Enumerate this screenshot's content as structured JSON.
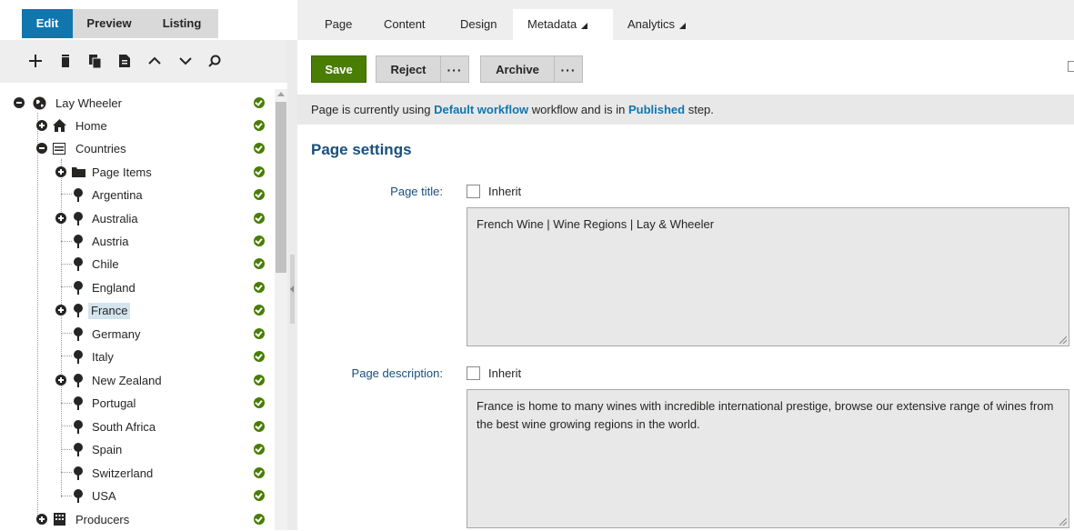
{
  "mode_tabs": [
    "Edit",
    "Preview",
    "Listing"
  ],
  "toolbar_icons": [
    "add-icon",
    "delete-icon",
    "copy-icon",
    "move-icon",
    "move-up-icon",
    "move-down-icon",
    "search-icon"
  ],
  "tree": {
    "root": "Lay Wheeler",
    "home": "Home",
    "countries": "Countries",
    "page_items": "Page Items",
    "countries_list": [
      "Argentina",
      "Australia",
      "Austria",
      "Chile",
      "England",
      "France",
      "Germany",
      "Italy",
      "New Zealand",
      "Portugal",
      "South Africa",
      "Spain",
      "Switzerland",
      "USA"
    ],
    "producers": "Producers",
    "selected": "France"
  },
  "top_tabs": {
    "page": "Page",
    "content": "Content",
    "design": "Design",
    "metadata": "Metadata",
    "analytics": "Analytics"
  },
  "actions": {
    "save": "Save",
    "reject": "Reject",
    "more1": "···",
    "archive": "Archive",
    "more2": "···"
  },
  "workflow": {
    "prefix": "Page is currently using ",
    "workflow_name": "Default workflow",
    "middle": " workflow and is in ",
    "step": "Published",
    "suffix": " step."
  },
  "settings": {
    "title": "Page settings",
    "page_title_label": "Page title:",
    "page_title_value": "French Wine | Wine Regions | Lay & Wheeler",
    "page_desc_label": "Page description:",
    "page_desc_value": "France is home to many wines with incredible international prestige, browse our extensive range of wines from the best wine growing regions in the world.",
    "inherit": "Inherit"
  },
  "colors": {
    "accent": "#1175ae",
    "save_green": "#497d04",
    "heading_blue": "#1a4e7c"
  }
}
